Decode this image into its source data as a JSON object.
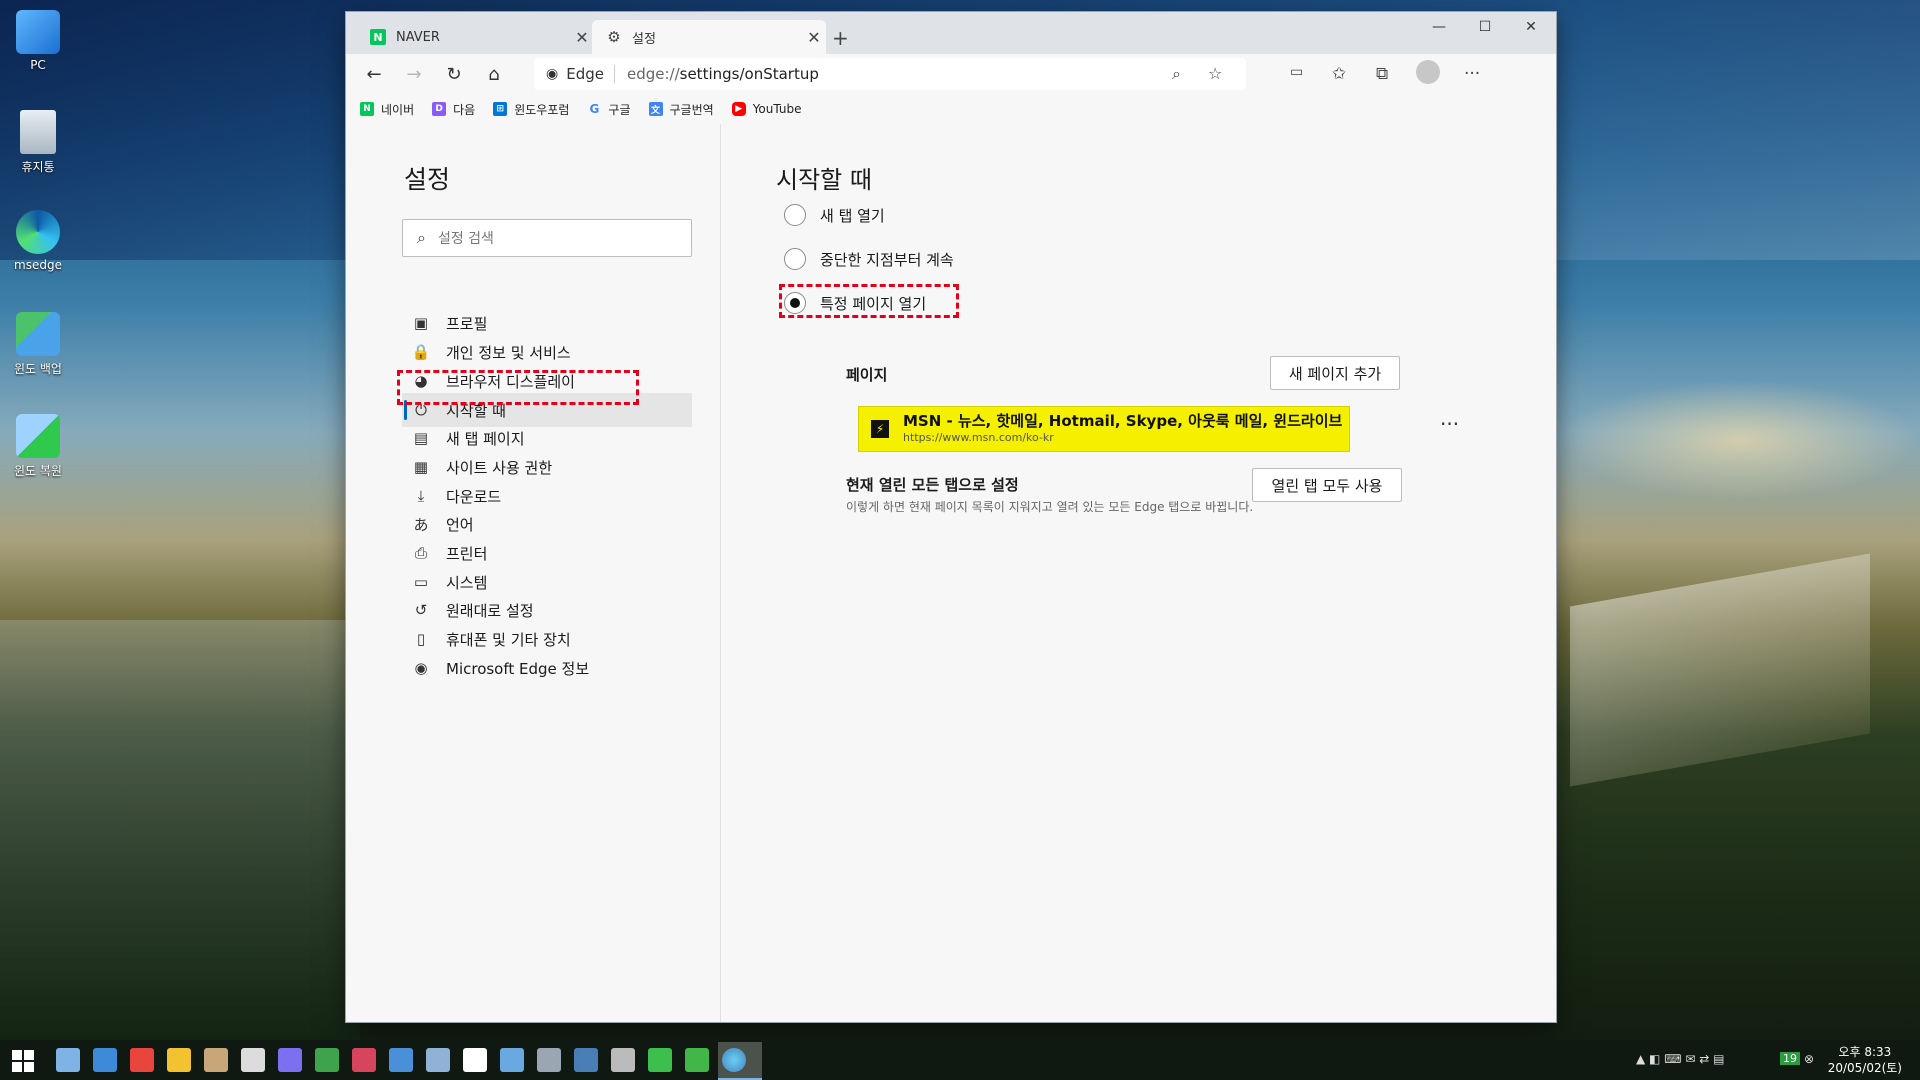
{
  "desktop": {
    "icons": [
      {
        "label": "PC"
      },
      {
        "label": "휴지통"
      },
      {
        "label": "msedge"
      },
      {
        "label": "윈도 백업"
      },
      {
        "label": "윈도 복원"
      }
    ]
  },
  "browser": {
    "tabs": [
      {
        "title": "NAVER",
        "favicon": "N"
      },
      {
        "title": "설정",
        "favicon": "gear"
      }
    ],
    "address": {
      "chip": "Edge",
      "url_prefix": "edge://",
      "url_path": "settings/onStartup"
    },
    "favorites": [
      {
        "label": "네이버",
        "color": "#03c75a",
        "glyph": "N"
      },
      {
        "label": "다음",
        "color": "#8a5cf6",
        "glyph": "D"
      },
      {
        "label": "윈도우포럼",
        "color": "#0078d4",
        "glyph": "⊞"
      },
      {
        "label": "구글",
        "color": "#ffffff",
        "glyph": "G"
      },
      {
        "label": "구글번역",
        "color": "#4285f4",
        "glyph": "文"
      },
      {
        "label": "YouTube",
        "color": "#ff0000",
        "glyph": "▶"
      }
    ]
  },
  "settings": {
    "title": "설정",
    "search_placeholder": "설정 검색",
    "menu": [
      {
        "label": "프로필",
        "icon": "profile-icon",
        "glyph": "▣"
      },
      {
        "label": "개인 정보 및 서비스",
        "icon": "lock-icon",
        "glyph": "🔒"
      },
      {
        "label": "브라우저 디스플레이",
        "icon": "palette-icon",
        "glyph": "◕"
      },
      {
        "label": "시작할 때",
        "icon": "power-icon",
        "glyph": "⏻"
      },
      {
        "label": "새 탭 페이지",
        "icon": "newtab-icon",
        "glyph": "▤"
      },
      {
        "label": "사이트 사용 권한",
        "icon": "site-permissions-icon",
        "glyph": "▦"
      },
      {
        "label": "다운로드",
        "icon": "download-icon",
        "glyph": "⤓"
      },
      {
        "label": "언어",
        "icon": "language-icon",
        "glyph": "あ"
      },
      {
        "label": "프린터",
        "icon": "printer-icon",
        "glyph": "⎙"
      },
      {
        "label": "시스템",
        "icon": "system-icon",
        "glyph": "▭"
      },
      {
        "label": "원래대로 설정",
        "icon": "reset-icon",
        "glyph": "↺"
      },
      {
        "label": "휴대폰 및 기타 장치",
        "icon": "phone-icon",
        "glyph": "▯"
      },
      {
        "label": "Microsoft Edge 정보",
        "icon": "edge-icon",
        "glyph": "◉"
      }
    ],
    "selected_index": 3
  },
  "startup": {
    "title": "시작할 때",
    "options": [
      {
        "label": "새 탭 열기",
        "selected": false
      },
      {
        "label": "중단한 지점부터 계속",
        "selected": false
      },
      {
        "label": "특정 페이지 열기",
        "selected": true
      }
    ],
    "pages_label": "페이지",
    "add_page_button": "새 페이지 추가",
    "page": {
      "name": "MSN - 뉴스, 핫메일, Hotmail, Skype, 아웃룩 메일, 윈드라이브",
      "url": "https://www.msn.com/ko-kr"
    },
    "more": "···",
    "use_open_tabs_label": "현재 열린 모든 탭으로 설정",
    "use_open_tabs_desc": "이렇게 하면 현재 페이지 목록이 지워지고 열려 있는 모든 Edge 탭으로 바뀝니다.",
    "use_open_tabs_button": "열린 탭 모두 사용"
  },
  "taskbar": {
    "clock_time": "오후 8:33",
    "clock_date": "20/05/02(토)",
    "badge": "19"
  }
}
